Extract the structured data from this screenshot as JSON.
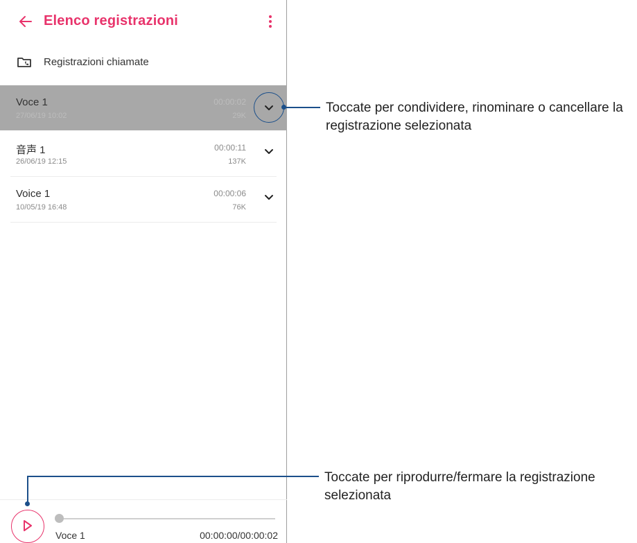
{
  "appbar": {
    "title": "Elenco registrazioni",
    "accent_color": "#e8336b",
    "back_icon": "arrow-left-icon",
    "more_icon": "more-vertical-icon"
  },
  "folder": {
    "label": "Registrazioni chiamate",
    "icon": "folder-phone-icon"
  },
  "recordings": [
    {
      "name": "Voce 1",
      "date": "27/06/19 10:02",
      "duration": "00:00:02",
      "size": "29K",
      "selected": true
    },
    {
      "name": "音声 1",
      "date": "26/06/19 12:15",
      "duration": "00:00:11",
      "size": "137K",
      "selected": false
    },
    {
      "name": "Voice 1",
      "date": "10/05/19 16:48",
      "duration": "00:00:06",
      "size": "76K",
      "selected": false
    }
  ],
  "player": {
    "current_name": "Voce 1",
    "time": "00:00:00/00:00:02",
    "progress": 0,
    "play_icon": "play-icon"
  },
  "callouts": {
    "options": "Toccate per condividere, rinominare o cancellare la registrazione selezionata",
    "play": "Toccate per riprodurre/fermare la registrazione selezionata",
    "line_color": "#1b4f8a"
  }
}
